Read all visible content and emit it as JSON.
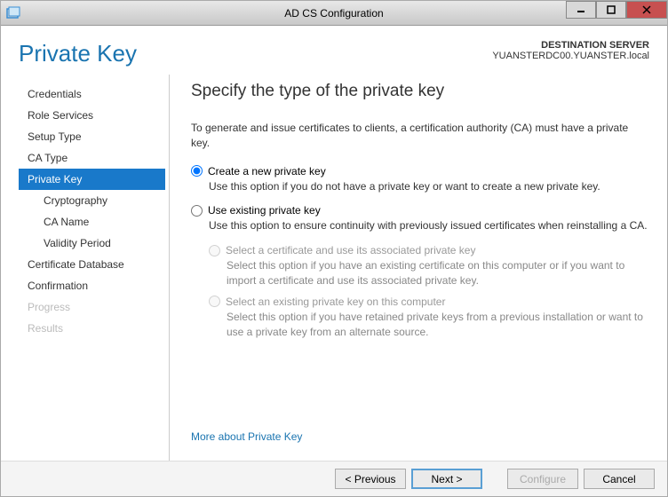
{
  "window": {
    "title": "AD CS Configuration"
  },
  "header": {
    "page_title": "Private Key",
    "dest_label": "DESTINATION SERVER",
    "dest_value": "YUANSTERDC00.YUANSTER.local"
  },
  "sidebar": {
    "items": [
      {
        "label": "Credentials",
        "sub": false,
        "active": false,
        "disabled": false
      },
      {
        "label": "Role Services",
        "sub": false,
        "active": false,
        "disabled": false
      },
      {
        "label": "Setup Type",
        "sub": false,
        "active": false,
        "disabled": false
      },
      {
        "label": "CA Type",
        "sub": false,
        "active": false,
        "disabled": false
      },
      {
        "label": "Private Key",
        "sub": false,
        "active": true,
        "disabled": false
      },
      {
        "label": "Cryptography",
        "sub": true,
        "active": false,
        "disabled": false
      },
      {
        "label": "CA Name",
        "sub": true,
        "active": false,
        "disabled": false
      },
      {
        "label": "Validity Period",
        "sub": true,
        "active": false,
        "disabled": false
      },
      {
        "label": "Certificate Database",
        "sub": false,
        "active": false,
        "disabled": false
      },
      {
        "label": "Confirmation",
        "sub": false,
        "active": false,
        "disabled": false
      },
      {
        "label": "Progress",
        "sub": false,
        "active": false,
        "disabled": true
      },
      {
        "label": "Results",
        "sub": false,
        "active": false,
        "disabled": true
      }
    ]
  },
  "main": {
    "heading": "Specify the type of the private key",
    "intro": "To generate and issue certificates to clients, a certification authority (CA) must have a private key.",
    "opt_create": {
      "label": "Create a new private key",
      "desc": "Use this option if you do not have a private key or want to create a new private key.",
      "selected": true
    },
    "opt_existing": {
      "label": "Use existing private key",
      "desc": "Use this option to ensure continuity with previously issued certificates when reinstalling a CA.",
      "selected": false,
      "sub1": {
        "label": "Select a certificate and use its associated private key",
        "desc": "Select this option if you have an existing certificate on this computer or if you want to import a certificate and use its associated private key."
      },
      "sub2": {
        "label": "Select an existing private key on this computer",
        "desc": "Select this option if you have retained private keys from a previous installation or want to use a private key from an alternate source."
      }
    },
    "more_link": "More about Private Key"
  },
  "footer": {
    "previous": "< Previous",
    "next": "Next >",
    "configure": "Configure",
    "cancel": "Cancel"
  }
}
